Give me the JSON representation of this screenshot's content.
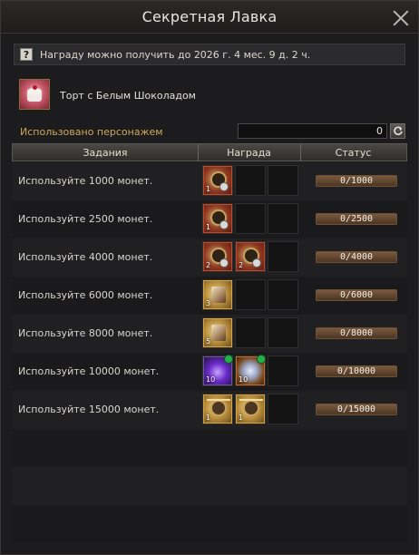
{
  "window": {
    "title": "Секретная Лавка"
  },
  "notice": {
    "icon": "question-icon",
    "text": "Награду можно получить до 2026 г. 4 мес. 9 д. 2 ч."
  },
  "item": {
    "name": "Торт с Белым Шоколадом",
    "icon": "cake-icon"
  },
  "usage": {
    "label": "Использовано персонажем",
    "value": "0"
  },
  "table": {
    "headers": {
      "task": "Задания",
      "reward": "Награда",
      "status": "Статус"
    },
    "rows": [
      {
        "task": "Используйте 1000 монет.",
        "status": "0/1000",
        "rewards": [
          {
            "icon": "shield-emblem-icon",
            "style": "red",
            "count": "1"
          }
        ]
      },
      {
        "task": "Используйте 2500 монет.",
        "status": "0/2500",
        "rewards": [
          {
            "icon": "sword-emblem-icon",
            "style": "red",
            "count": "1"
          }
        ]
      },
      {
        "task": "Используйте 4000 монет.",
        "status": "0/4000",
        "rewards": [
          {
            "icon": "shield-emblem-icon",
            "style": "red",
            "count": "2"
          },
          {
            "icon": "sword-emblem-icon",
            "style": "red",
            "count": "2"
          }
        ]
      },
      {
        "task": "Используйте 6000 монет.",
        "status": "0/6000",
        "rewards": [
          {
            "icon": "hammer-icon",
            "style": "gold",
            "count": "3"
          }
        ]
      },
      {
        "task": "Используйте 8000 монет.",
        "status": "0/8000",
        "rewards": [
          {
            "icon": "hammer-icon",
            "style": "gold",
            "count": "5"
          }
        ]
      },
      {
        "task": "Используйте 10000 монет.",
        "status": "0/10000",
        "rewards": [
          {
            "icon": "purple-crystal-icon",
            "style": "purple",
            "count": "10"
          },
          {
            "icon": "coin-scroll-icon",
            "style": "orange",
            "count": "10"
          }
        ]
      },
      {
        "task": "Используйте 15000 монет.",
        "status": "0/15000",
        "rewards": [
          {
            "icon": "gold-arrow-emblem-icon",
            "style": "gold",
            "count": "1"
          },
          {
            "icon": "gold-arrow-emblem-icon",
            "style": "gold",
            "count": "1"
          }
        ]
      }
    ]
  },
  "colors": {
    "label_gold": "#d2a85a",
    "status_bg": "#5e4330",
    "bg": "#1c1c1e"
  }
}
